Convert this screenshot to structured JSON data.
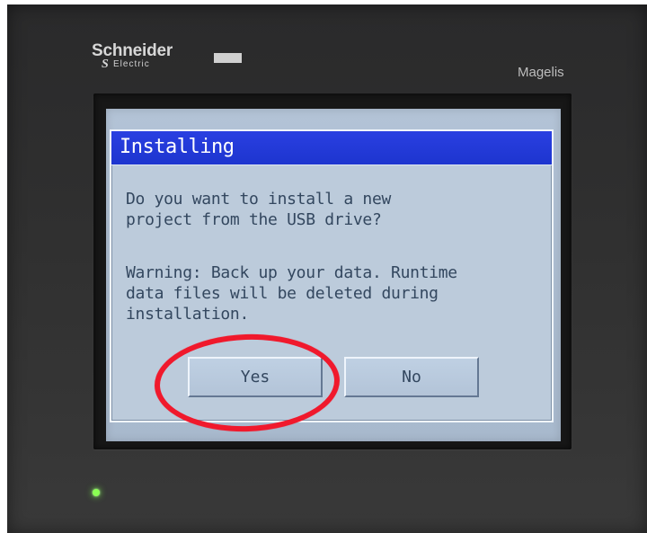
{
  "device": {
    "brand_name": "Schneider",
    "brand_subtitle": "Electric",
    "brand_mark": "S",
    "model_name": "Magelis"
  },
  "dialog": {
    "title": "Installing",
    "message_line_1": "Do you want to install a new",
    "message_line_2": "project from the USB drive?",
    "warning_line_1": "Warning: Back up your data. Runtime",
    "warning_line_2": "data files will be deleted during",
    "warning_line_3": "installation.",
    "yes_label": "Yes",
    "no_label": "No"
  },
  "colors": {
    "title_bar": "#1d35cf",
    "screen": "#bccbdb",
    "highlight": "#f0192c",
    "power_led": "#8bff53"
  }
}
